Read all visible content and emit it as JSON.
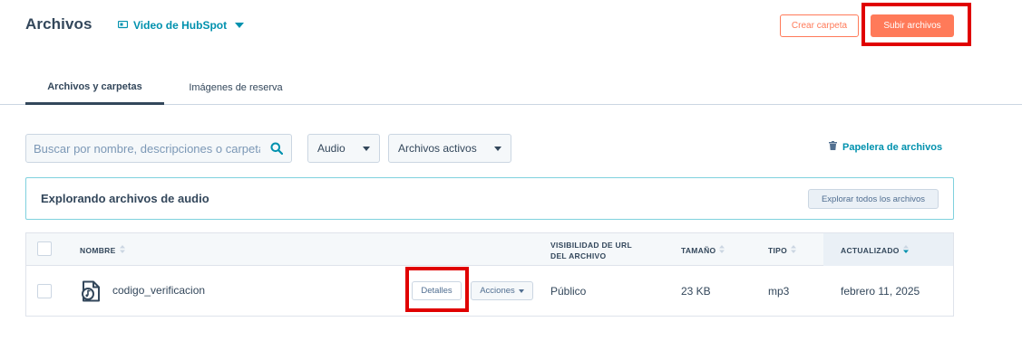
{
  "header": {
    "title": "Archivos",
    "video_link": "Video de HubSpot",
    "create_folder": "Crear carpeta",
    "upload_files": "Subir archivos"
  },
  "tabs": [
    {
      "label": "Archivos y carpetas",
      "active": true
    },
    {
      "label": "Imágenes de reserva",
      "active": false
    }
  ],
  "filters": {
    "search_placeholder": "Buscar por nombre, descripciones o carpetas",
    "type_filter": "Audio",
    "status_filter": "Archivos activos",
    "trash_link": "Papelera de archivos"
  },
  "banner": {
    "title": "Explorando archivos de audio",
    "button": "Explorar todos los archivos"
  },
  "table": {
    "columns": {
      "name": "NOMBRE",
      "visibility_line1": "VISIBILIDAD DE URL",
      "visibility_line2": "DEL ARCHIVO",
      "size": "TAMAÑO",
      "type": "TIPO",
      "updated": "ACTUALIZADO"
    },
    "rows": [
      {
        "name": "codigo_verificacion",
        "details_button": "Detalles",
        "actions_button": "Acciones",
        "visibility": "Público",
        "size": "23 KB",
        "type": "mp3",
        "updated": "febrero 11, 2025"
      }
    ]
  },
  "colors": {
    "accent": "#ff7a59",
    "link": "#0091ae",
    "text": "#33475b",
    "highlight": "#e00000"
  }
}
